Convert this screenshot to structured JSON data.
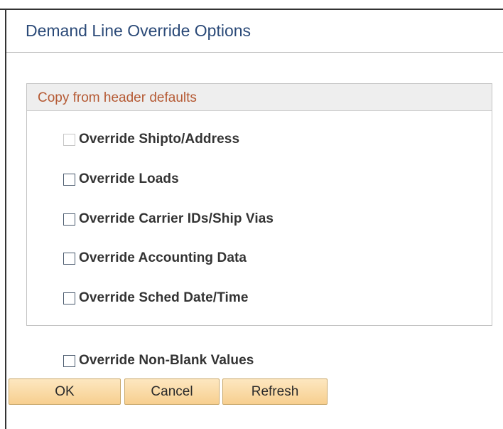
{
  "dialog": {
    "title": "Demand Line Override Options"
  },
  "group": {
    "header": "Copy from header defaults",
    "options": [
      {
        "label": "Override Shipto/Address",
        "checked": false,
        "disabled": true
      },
      {
        "label": "Override Loads",
        "checked": false,
        "disabled": false
      },
      {
        "label": "Override Carrier IDs/Ship Vias",
        "checked": false,
        "disabled": false
      },
      {
        "label": "Override Accounting Data",
        "checked": false,
        "disabled": false
      },
      {
        "label": "Override Sched Date/Time",
        "checked": false,
        "disabled": false
      }
    ]
  },
  "override_non_blank": {
    "label": "Override Non-Blank Values",
    "checked": false
  },
  "buttons": {
    "ok": "OK",
    "cancel": "Cancel",
    "refresh": "Refresh"
  },
  "colors": {
    "title": "#2b4a78",
    "group_header_text": "#b55a34",
    "button_bg": "#f7cf8f"
  }
}
